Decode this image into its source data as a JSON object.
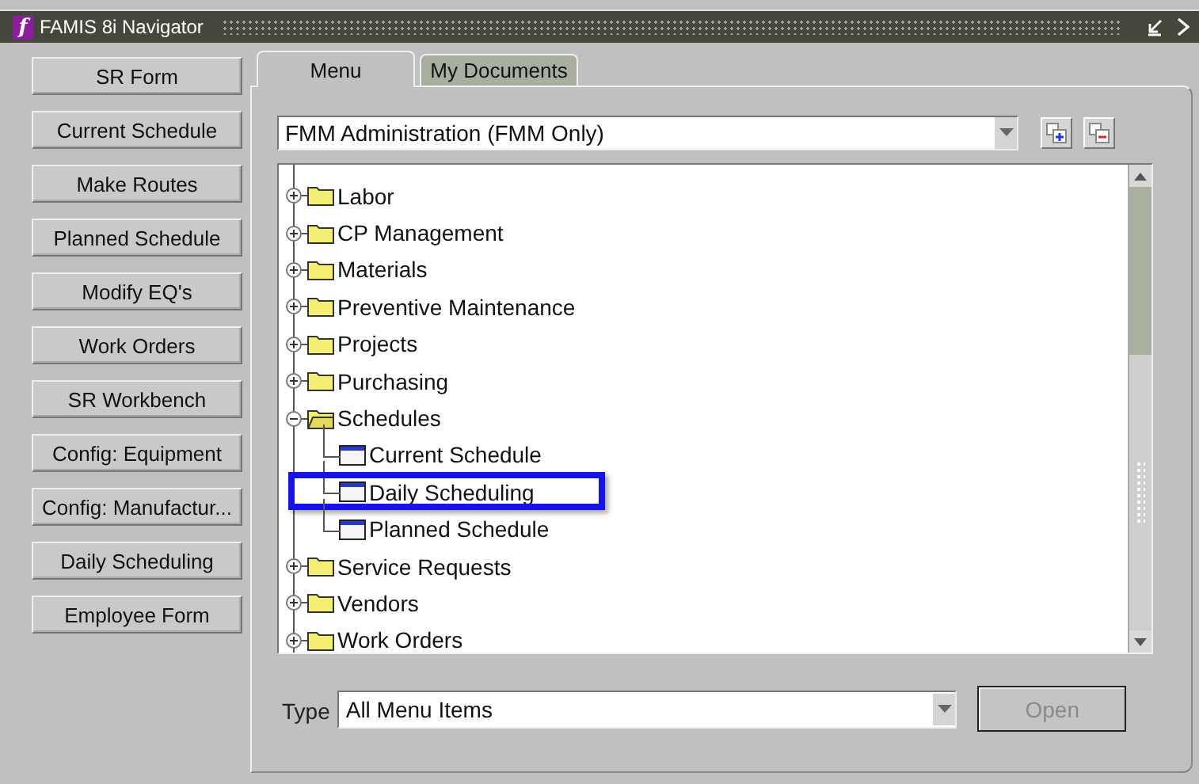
{
  "window": {
    "logo": "f",
    "title": "FAMIS 8i Navigator"
  },
  "side_buttons": [
    "SR Form",
    "Current Schedule",
    "Make Routes",
    "Planned Schedule",
    "Modify EQ's",
    "Work Orders",
    "SR Workbench",
    "Config: Equipment",
    "Config: Manufactur...",
    "Daily Scheduling",
    "Employee Form"
  ],
  "tabs": [
    {
      "label": "Menu",
      "selected": true
    },
    {
      "label": "My Documents",
      "selected": false
    }
  ],
  "menu_select": {
    "value": "FMM Administration (FMM Only)"
  },
  "tree": [
    {
      "kind": "folder",
      "label": "Labor",
      "expanded": false
    },
    {
      "kind": "folder",
      "label": "CP Management",
      "expanded": false
    },
    {
      "kind": "folder",
      "label": "Materials",
      "expanded": false
    },
    {
      "kind": "folder",
      "label": "Preventive Maintenance",
      "expanded": false
    },
    {
      "kind": "folder",
      "label": "Projects",
      "expanded": false
    },
    {
      "kind": "folder",
      "label": "Purchasing",
      "expanded": false
    },
    {
      "kind": "folder",
      "label": "Schedules",
      "expanded": true,
      "children": [
        {
          "kind": "form",
          "label": "Current Schedule",
          "highlighted": false
        },
        {
          "kind": "form",
          "label": "Daily Scheduling",
          "highlighted": true
        },
        {
          "kind": "form",
          "label": "Planned Schedule",
          "highlighted": false
        }
      ]
    },
    {
      "kind": "folder",
      "label": "Service Requests",
      "expanded": false
    },
    {
      "kind": "folder",
      "label": "Vendors",
      "expanded": false
    },
    {
      "kind": "folder",
      "label": "Work Orders",
      "expanded": false
    }
  ],
  "type_filter": {
    "label": "Type",
    "value": "All Menu Items"
  },
  "open_button": {
    "label": "Open",
    "disabled": true
  }
}
